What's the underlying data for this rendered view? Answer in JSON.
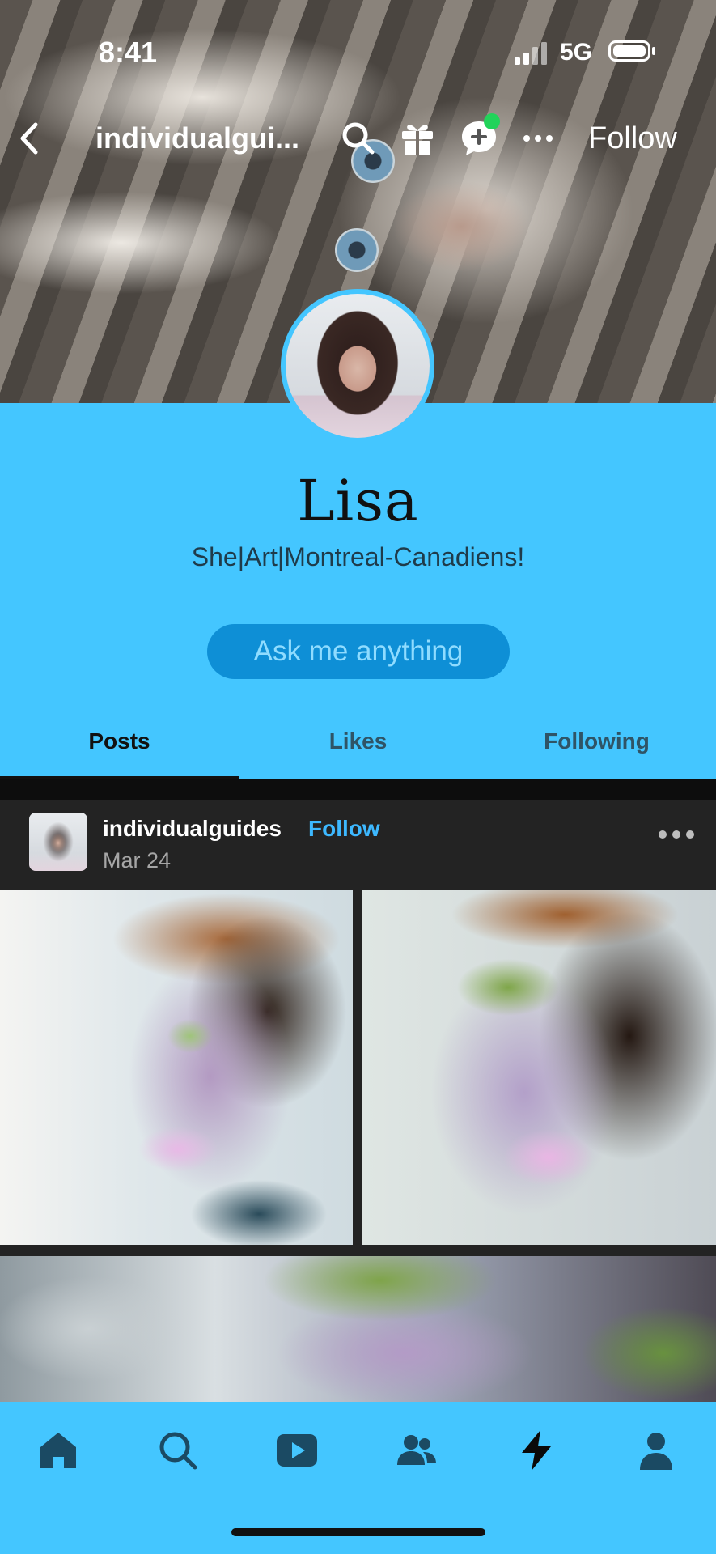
{
  "status_bar": {
    "time": "8:41",
    "network": "5G"
  },
  "top_nav": {
    "blog_title": "individualgui...",
    "follow_label": "Follow",
    "icons": [
      "back-chevron-icon",
      "search-icon",
      "gift-icon",
      "new-chat-icon",
      "more-icon"
    ]
  },
  "profile": {
    "name": "Lisa",
    "description": "She|Art|Montreal-Canadiens!",
    "ask_button": "Ask me anything"
  },
  "tabs": [
    {
      "label": "Posts",
      "active": true
    },
    {
      "label": "Likes",
      "active": false
    },
    {
      "label": "Following",
      "active": false
    }
  ],
  "post": {
    "username": "individualguides",
    "follow_label": "Follow",
    "date": "Mar 24"
  },
  "bottom_nav": {
    "items": [
      "home-icon",
      "search-icon",
      "video-icon",
      "community-icon",
      "activity-icon",
      "account-icon"
    ],
    "active": "activity-icon"
  },
  "colors": {
    "accent": "#44c6ff",
    "button": "#0e8fd6",
    "follow_link": "#3db8ff",
    "online_dot": "#22d35a"
  }
}
